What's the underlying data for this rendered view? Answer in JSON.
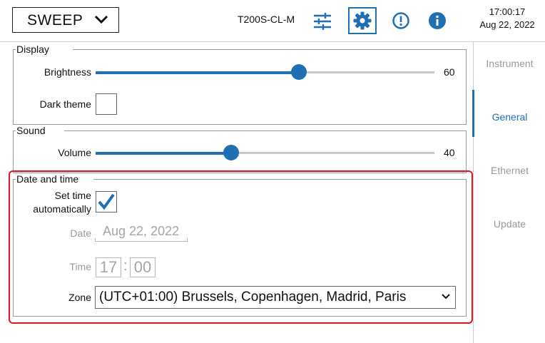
{
  "header": {
    "mode": "SWEEP",
    "device": "T200S-CL-M",
    "time": "17:00:17",
    "date": "Aug 22, 2022"
  },
  "nav": {
    "items": [
      "Instrument",
      "General",
      "Ethernet",
      "Update"
    ],
    "active": "General"
  },
  "display": {
    "title": "Display",
    "brightness_label": "Brightness",
    "brightness_value": "60",
    "brightness_level": 0.6,
    "dark_theme_label": "Dark theme",
    "dark_theme_checked": false
  },
  "sound": {
    "title": "Sound",
    "volume_label": "Volume",
    "volume_value": "40",
    "volume_level": 0.4
  },
  "datetime": {
    "title": "Date and time",
    "auto_label_1": "Set time",
    "auto_label_2": "automatically",
    "auto_checked": true,
    "date_label": "Date",
    "date_value": "Aug 22, 2022",
    "time_label": "Time",
    "hour": "17",
    "minute": "00",
    "separator": ":",
    "zone_label": "Zone",
    "zone_value": "(UTC+01:00) Brussels, Copenhagen, Madrid, Paris"
  },
  "colors": {
    "accent": "#1f6fb3",
    "highlight": "#e0141e"
  },
  "icons": [
    "chevron-down-icon",
    "sliders-icon",
    "gear-icon",
    "alert-icon",
    "info-icon",
    "checkmark-icon"
  ]
}
